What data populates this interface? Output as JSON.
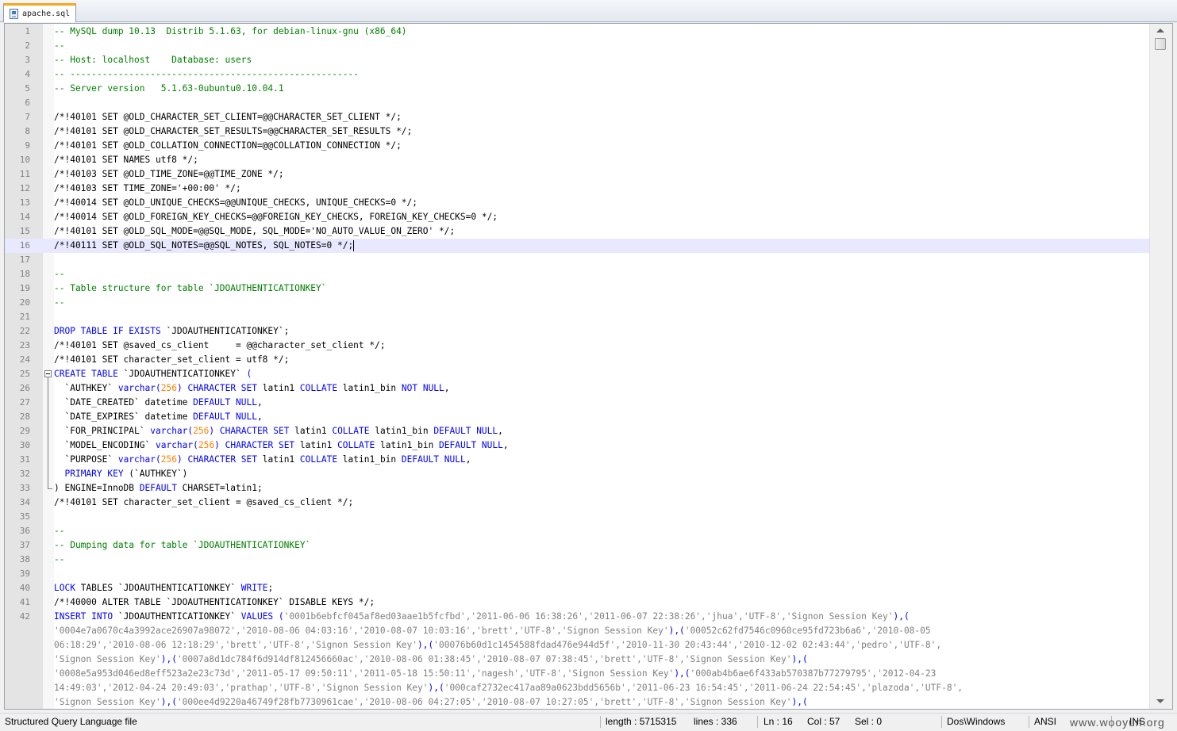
{
  "tab": {
    "label": "apache.sql"
  },
  "editor": {
    "current_line": 16,
    "lines": [
      {
        "n": "1",
        "tokens": [
          [
            "cmt",
            "-- MySQL dump 10.13  Distrib 5.1.63, for debian-linux-gnu (x86_64)"
          ]
        ]
      },
      {
        "n": "2",
        "tokens": [
          [
            "cmt",
            "--"
          ]
        ]
      },
      {
        "n": "3",
        "tokens": [
          [
            "cmt",
            "-- Host: localhost    Database: users"
          ]
        ]
      },
      {
        "n": "4",
        "tokens": [
          [
            "cmt",
            "-- ------------------------------------------------------"
          ]
        ]
      },
      {
        "n": "5",
        "tokens": [
          [
            "cmt",
            "-- Server version   5.1.63-0ubuntu0.10.04.1"
          ]
        ]
      },
      {
        "n": "6",
        "tokens": []
      },
      {
        "n": "7",
        "tokens": [
          [
            "",
            "/*!40101 SET @OLD_CHARACTER_SET_CLIENT=@@CHARACTER_SET_CLIENT */;"
          ]
        ]
      },
      {
        "n": "8",
        "tokens": [
          [
            "",
            "/*!40101 SET @OLD_CHARACTER_SET_RESULTS=@@CHARACTER_SET_RESULTS */;"
          ]
        ]
      },
      {
        "n": "9",
        "tokens": [
          [
            "",
            "/*!40101 SET @OLD_COLLATION_CONNECTION=@@COLLATION_CONNECTION */;"
          ]
        ]
      },
      {
        "n": "10",
        "tokens": [
          [
            "",
            "/*!40101 SET NAMES utf8 */;"
          ]
        ]
      },
      {
        "n": "11",
        "tokens": [
          [
            "",
            "/*!40103 SET @OLD_TIME_ZONE=@@TIME_ZONE */;"
          ]
        ]
      },
      {
        "n": "12",
        "tokens": [
          [
            "",
            "/*!40103 SET TIME_ZONE='+00:00' */;"
          ]
        ]
      },
      {
        "n": "13",
        "tokens": [
          [
            "",
            "/*!40014 SET @OLD_UNIQUE_CHECKS=@@UNIQUE_CHECKS, UNIQUE_CHECKS=0 */;"
          ]
        ]
      },
      {
        "n": "14",
        "tokens": [
          [
            "",
            "/*!40014 SET @OLD_FOREIGN_KEY_CHECKS=@@FOREIGN_KEY_CHECKS, FOREIGN_KEY_CHECKS=0 */;"
          ]
        ]
      },
      {
        "n": "15",
        "tokens": [
          [
            "",
            "/*!40101 SET @OLD_SQL_MODE=@@SQL_MODE, SQL_MODE='NO_AUTO_VALUE_ON_ZERO' */;"
          ]
        ]
      },
      {
        "n": "16",
        "tokens": [
          [
            "",
            "/*!40111 SET @OLD_SQL_NOTES=@@SQL_NOTES, SQL_NOTES=0 */;"
          ]
        ]
      },
      {
        "n": "17",
        "tokens": []
      },
      {
        "n": "18",
        "tokens": [
          [
            "cmt",
            "--"
          ]
        ]
      },
      {
        "n": "19",
        "tokens": [
          [
            "cmt",
            "-- Table structure for table `JDOAUTHENTICATIONKEY`"
          ]
        ]
      },
      {
        "n": "20",
        "tokens": [
          [
            "cmt",
            "--"
          ]
        ]
      },
      {
        "n": "21",
        "tokens": []
      },
      {
        "n": "22",
        "tokens": [
          [
            "kw",
            "DROP TABLE IF EXISTS"
          ],
          [
            "",
            " `JDOAUTHENTICATIONKEY`;"
          ]
        ]
      },
      {
        "n": "23",
        "tokens": [
          [
            "",
            "/*!40101 SET @saved_cs_client     = @@character_set_client */;"
          ]
        ]
      },
      {
        "n": "24",
        "tokens": [
          [
            "",
            "/*!40101 SET character_set_client = utf8 */;"
          ]
        ]
      },
      {
        "n": "25",
        "tokens": [
          [
            "kw",
            "CREATE TABLE"
          ],
          [
            "",
            " `JDOAUTHENTICATIONKEY` "
          ],
          [
            "kw",
            "("
          ]
        ]
      },
      {
        "n": "26",
        "tokens": [
          [
            "",
            "  `AUTHKEY` "
          ],
          [
            "kw",
            "varchar"
          ],
          [
            "kw",
            "("
          ],
          [
            "num",
            "256"
          ],
          [
            "kw",
            ")"
          ],
          [
            "",
            " "
          ],
          [
            "kw",
            "CHARACTER SET"
          ],
          [
            "",
            " latin1 "
          ],
          [
            "kw",
            "COLLATE"
          ],
          [
            "",
            " latin1_bin "
          ],
          [
            "kw",
            "NOT NULL"
          ],
          [
            "",
            ","
          ]
        ]
      },
      {
        "n": "27",
        "tokens": [
          [
            "",
            "  `DATE_CREATED` datetime "
          ],
          [
            "kw",
            "DEFAULT NULL"
          ],
          [
            "",
            ","
          ]
        ]
      },
      {
        "n": "28",
        "tokens": [
          [
            "",
            "  `DATE_EXPIRES` datetime "
          ],
          [
            "kw",
            "DEFAULT NULL"
          ],
          [
            "",
            ","
          ]
        ]
      },
      {
        "n": "29",
        "tokens": [
          [
            "",
            "  `FOR_PRINCIPAL` "
          ],
          [
            "kw",
            "varchar"
          ],
          [
            "kw",
            "("
          ],
          [
            "num",
            "256"
          ],
          [
            "kw",
            ")"
          ],
          [
            "",
            " "
          ],
          [
            "kw",
            "CHARACTER SET"
          ],
          [
            "",
            " latin1 "
          ],
          [
            "kw",
            "COLLATE"
          ],
          [
            "",
            " latin1_bin "
          ],
          [
            "kw",
            "DEFAULT NULL"
          ],
          [
            "",
            ","
          ]
        ]
      },
      {
        "n": "30",
        "tokens": [
          [
            "",
            "  `MODEL_ENCODING` "
          ],
          [
            "kw",
            "varchar"
          ],
          [
            "kw",
            "("
          ],
          [
            "num",
            "256"
          ],
          [
            "kw",
            ")"
          ],
          [
            "",
            " "
          ],
          [
            "kw",
            "CHARACTER SET"
          ],
          [
            "",
            " latin1 "
          ],
          [
            "kw",
            "COLLATE"
          ],
          [
            "",
            " latin1_bin "
          ],
          [
            "kw",
            "DEFAULT NULL"
          ],
          [
            "",
            ","
          ]
        ]
      },
      {
        "n": "31",
        "tokens": [
          [
            "",
            "  `PURPOSE` "
          ],
          [
            "kw",
            "varchar"
          ],
          [
            "kw",
            "("
          ],
          [
            "num",
            "256"
          ],
          [
            "kw",
            ")"
          ],
          [
            "",
            " "
          ],
          [
            "kw",
            "CHARACTER SET"
          ],
          [
            "",
            " latin1 "
          ],
          [
            "kw",
            "COLLATE"
          ],
          [
            "",
            " latin1_bin "
          ],
          [
            "kw",
            "DEFAULT NULL"
          ],
          [
            "",
            ","
          ]
        ]
      },
      {
        "n": "32",
        "tokens": [
          [
            "",
            "  "
          ],
          [
            "kw",
            "PRIMARY KEY"
          ],
          [
            "",
            " (`AUTHKEY`)"
          ]
        ]
      },
      {
        "n": "33",
        "tokens": [
          [
            "",
            ") ENGINE=InnoDB "
          ],
          [
            "kw",
            "DEFAULT"
          ],
          [
            "",
            " CHARSET=latin1;"
          ]
        ]
      },
      {
        "n": "34",
        "tokens": [
          [
            "",
            "/*!40101 SET character_set_client = @saved_cs_client */;"
          ]
        ]
      },
      {
        "n": "35",
        "tokens": []
      },
      {
        "n": "36",
        "tokens": [
          [
            "cmt",
            "--"
          ]
        ]
      },
      {
        "n": "37",
        "tokens": [
          [
            "cmt",
            "-- Dumping data for table `JDOAUTHENTICATIONKEY`"
          ]
        ]
      },
      {
        "n": "38",
        "tokens": [
          [
            "cmt",
            "--"
          ]
        ]
      },
      {
        "n": "39",
        "tokens": []
      },
      {
        "n": "40",
        "tokens": [
          [
            "kw",
            "LOCK"
          ],
          [
            "",
            " TABLES `JDOAUTHENTICATIONKEY` "
          ],
          [
            "kw",
            "WRITE"
          ],
          [
            "",
            ";"
          ]
        ]
      },
      {
        "n": "41",
        "tokens": [
          [
            "",
            "/*!40000 ALTER TABLE `JDOAUTHENTICATIONKEY` DISABLE KEYS */;"
          ]
        ]
      },
      {
        "n": "42",
        "tokens": [
          [
            "kw",
            "INSERT INTO"
          ],
          [
            "",
            " `JDOAUTHENTICATIONKEY` "
          ],
          [
            "kw",
            "VALUES"
          ],
          [
            "",
            " "
          ],
          [
            "kw",
            "("
          ],
          [
            "str",
            "'0001b6ebfcf045af8ed03aae1b5fcfbd','2011-06-06 16:38:26','2011-06-07 22:38:26','jhua','UTF-8','Signon Session Key'"
          ],
          [
            "kw",
            "),("
          ]
        ]
      },
      {
        "n": "",
        "tokens": [
          [
            "str",
            "'0004e7a0670c4a3992ace26907a98072','2010-08-06 04:03:16','2010-08-07 10:03:16','brett','UTF-8','Signon Session Key'"
          ],
          [
            "kw",
            "),("
          ],
          [
            "str",
            "'00052c62fd7546c0960ce95fd723b6a6','2010-08-05"
          ]
        ]
      },
      {
        "n": "",
        "tokens": [
          [
            "str",
            "06:18:29','2010-08-06 12:18:29','brett','UTF-8','Signon Session Key'"
          ],
          [
            "kw",
            "),("
          ],
          [
            "str",
            "'00076b60d1c1454588fdad476e944d5f','2010-11-30 20:43:44','2010-12-02 02:43:44','pedro','UTF-8',"
          ]
        ]
      },
      {
        "n": "",
        "tokens": [
          [
            "str",
            "'Signon Session Key'"
          ],
          [
            "kw",
            "),("
          ],
          [
            "str",
            "'0007a8d1dc784f6d914df812456660ac','2010-08-06 01:38:45','2010-08-07 07:38:45','brett','UTF-8','Signon Session Key'"
          ],
          [
            "kw",
            "),("
          ]
        ]
      },
      {
        "n": "",
        "tokens": [
          [
            "str",
            "'0008e5a953d046ed8eff523a2e23c73d','2011-05-17 09:50:11','2011-05-18 15:50:11','nagesh','UTF-8','Signon Session Key'"
          ],
          [
            "kw",
            "),("
          ],
          [
            "str",
            "'000ab4b6ae6f433ab570387b77279795','2012-04-23"
          ]
        ]
      },
      {
        "n": "",
        "tokens": [
          [
            "str",
            "14:49:03','2012-04-24 20:49:03','prathap','UTF-8','Signon Session Key'"
          ],
          [
            "kw",
            "),("
          ],
          [
            "str",
            "'000caf2732ec417aa89a0623bdd5656b','2011-06-23 16:54:45','2011-06-24 22:54:45','plazoda','UTF-8',"
          ]
        ]
      },
      {
        "n": "",
        "tokens": [
          [
            "str",
            "'Signon Session Key'"
          ],
          [
            "kw",
            "),("
          ],
          [
            "str",
            "'000ee4d9220a46749f28fb7730961cae','2010-08-06 04:27:05','2010-08-07 10:27:05','brett','UTF-8','Signon Session Key'"
          ],
          [
            "kw",
            "),("
          ]
        ]
      }
    ]
  },
  "status": {
    "file_type": "Structured Query Language file",
    "length": "length : 5715315",
    "lines": "lines : 336",
    "ln": "Ln : 16",
    "col": "Col : 57",
    "sel": "Sel : 0",
    "eol": "Dos\\Windows",
    "encoding": "ANSI",
    "mode": "INS",
    "watermark": "www.wooyun.org"
  }
}
